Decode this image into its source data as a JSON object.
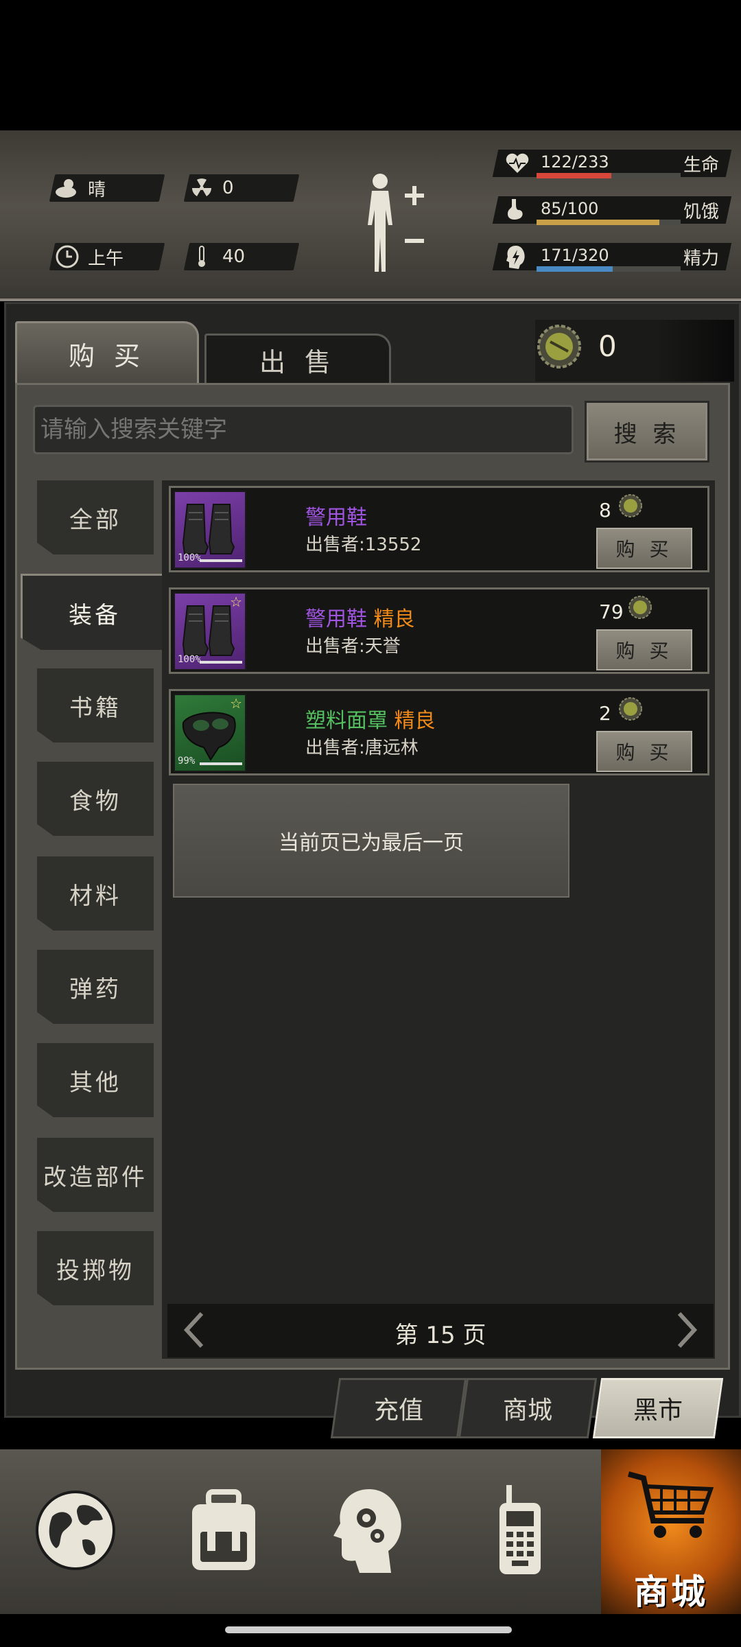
{
  "status": {
    "weather": "晴",
    "radiation": "0",
    "time_of_day": "上午",
    "temperature": "40",
    "health": {
      "value": "122/233",
      "label": "生命",
      "fraction": 0.52,
      "color": "#d9473a"
    },
    "hunger": {
      "value": "85/100",
      "label": "饥饿",
      "fraction": 0.85,
      "color": "#c9a048"
    },
    "energy": {
      "value": "171/320",
      "label": "精力",
      "fraction": 0.53,
      "color": "#4a8ac4"
    }
  },
  "tabs": {
    "buy": "购 买",
    "sell": "出 售"
  },
  "currency": {
    "count": "0"
  },
  "search": {
    "placeholder": "请输入搜索关键字",
    "button": "搜 索"
  },
  "categories": [
    "全部",
    "装备",
    "书籍",
    "食物",
    "材料",
    "弹药",
    "其他",
    "改造部件",
    "投掷物"
  ],
  "active_category": "装备",
  "items": [
    {
      "name": "警用鞋",
      "quality": "",
      "seller": "出售者:13552",
      "price": "8",
      "buy": "购 买",
      "durability": "100%"
    },
    {
      "name": "警用鞋",
      "quality": "精良",
      "seller": "出售者:天誉",
      "price": "79",
      "buy": "购 买",
      "durability": "100%"
    },
    {
      "name": "塑料面罩",
      "quality": "精良",
      "seller": "出售者:唐远林",
      "price": "2",
      "buy": "购 买",
      "durability": "99%"
    }
  ],
  "last_page_notice": "当前页已为最后一页",
  "pager": {
    "text": "第 15 页"
  },
  "bottom_tabs": {
    "recharge": "充值",
    "mall": "商城",
    "black_market": "黑市"
  },
  "bottom_nav": {
    "shop_label": "商城"
  }
}
